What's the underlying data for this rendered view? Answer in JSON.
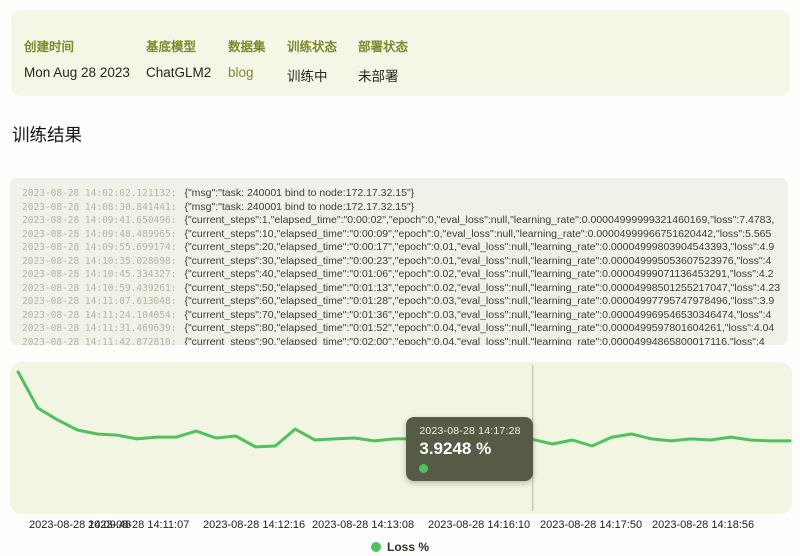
{
  "meta_card": {
    "fields": [
      {
        "label": "创建时间",
        "value": "Mon Aug 28 2023"
      },
      {
        "label": "基底模型",
        "value": "ChatGLM2"
      },
      {
        "label": "数据集",
        "value": "blog"
      },
      {
        "label": "训练状态",
        "value": "训练中"
      },
      {
        "label": "部署状态",
        "value": "未部署"
      }
    ]
  },
  "section_title": "训练结果",
  "logs": [
    {
      "time": "2023-08-28 14:02:02.121132:",
      "msg": "{\"msg\":\"task: 240001 bind to node:172.17.32.15\"}"
    },
    {
      "time": "2023-08-28 14:08:30.841441:",
      "msg": "{\"msg\":\"task: 240001 bind to node:172.17.32.15\"}"
    },
    {
      "time": "2023-08-28 14:09:41.650496:",
      "msg": "{\"current_steps\":1,\"elapsed_time\":\"0:00:02\",\"epoch\":0,\"eval_loss\":null,\"learning_rate\":0.00004999999321460169,\"loss\":7.4783,"
    },
    {
      "time": "2023-08-28 14:09:48.489965:",
      "msg": "{\"current_steps\":10,\"elapsed_time\":\"0:00:09\",\"epoch\":0,\"eval_loss\":null,\"learning_rate\":0.00004999966751620442,\"loss\":5.565"
    },
    {
      "time": "2023-08-28 14:09:55.699174:",
      "msg": "{\"current_steps\":20,\"elapsed_time\":\"0:00:17\",\"epoch\":0.01,\"eval_loss\":null,\"learning_rate\":0.00004999803904543393,\"loss\":4.9"
    },
    {
      "time": "2023-08-28 14:10:35.028098:",
      "msg": "{\"current_steps\":30,\"elapsed_time\":\"0:00:23\",\"epoch\":0.01,\"eval_loss\":null,\"learning_rate\":0.000049995053607523976,\"loss\":4"
    },
    {
      "time": "2023-08-28 14:10:45.334327:",
      "msg": "{\"current_steps\":40,\"elapsed_time\":\"0:01:06\",\"epoch\":0.02,\"eval_loss\":null,\"learning_rate\":0.00004999071136453291,\"loss\":4.2"
    },
    {
      "time": "2023-08-28 14:10:59.439261:",
      "msg": "{\"current_steps\":50,\"elapsed_time\":\"0:01:13\",\"epoch\":0.02,\"eval_loss\":null,\"learning_rate\":0.00004998501255217047,\"loss\":4.23"
    },
    {
      "time": "2023-08-28 14:11:07.613048:",
      "msg": "{\"current_steps\":60,\"elapsed_time\":\"0:01:28\",\"epoch\":0.03,\"eval_loss\":null,\"learning_rate\":0.00004997795747978496,\"loss\":3.9"
    },
    {
      "time": "2023-08-28 14:11:24.104054:",
      "msg": "{\"current_steps\":70,\"elapsed_time\":\"0:01:36\",\"epoch\":0.03,\"eval_loss\":null,\"learning_rate\":0.000049969546530346474,\"loss\":4"
    },
    {
      "time": "2023-08-28 14:11:31.469639:",
      "msg": "{\"current_steps\":80,\"elapsed_time\":\"0:01:52\",\"epoch\":0.04,\"eval_loss\":null,\"learning_rate\":0.0000499597801604261,\"loss\":4.04"
    },
    {
      "time": "2023-08-28 14:11:42.872810:",
      "msg": "{\"current_steps\":90,\"elapsed_time\":\"0:02:00\",\"epoch\":0.04,\"eval_loss\":null,\"learning_rate\":0.00004994865800017116,\"loss\":4"
    }
  ],
  "chart_data": {
    "type": "line",
    "title": "",
    "xlabel": "",
    "ylabel": "",
    "ylim": [
      0,
      8
    ],
    "grid": false,
    "legend_position": "bottom-center",
    "line_color": "#4ec25d",
    "crosshair_color": "#c9c9c0",
    "x_tick_labels": [
      "2023-08-28 14:09:48",
      "2023-08-28 14:11:07",
      "2023-08-28 14:12:16",
      "2023-08-28 14:13:08",
      "2023-08-28 14:16:10",
      "2023-08-28 14:17:50",
      "2023-08-28 14:18:56"
    ],
    "series": [
      {
        "name": "Loss %",
        "values": [
          7.62,
          5.64,
          4.99,
          4.44,
          4.22,
          4.16,
          3.95,
          4.05,
          4.05,
          4.38,
          4.0,
          4.11,
          3.51,
          3.56,
          4.49,
          3.89,
          3.95,
          4.0,
          3.84,
          3.95,
          3.95,
          3.78,
          3.84,
          3.73,
          3.78,
          3.84,
          3.9248,
          3.67,
          3.89,
          3.56,
          4.05,
          4.22,
          3.95,
          3.84,
          3.95,
          3.89,
          4.05,
          3.89,
          3.84,
          3.84
        ]
      }
    ],
    "tooltip": {
      "time": "2023-08-28 14:17:28",
      "value_label": "3.9248 %",
      "index": 26
    }
  }
}
